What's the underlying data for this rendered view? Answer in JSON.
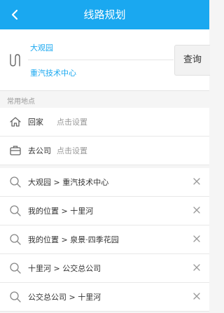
{
  "header": {
    "title": "线路规划"
  },
  "route": {
    "from": "大观园",
    "to": "重汽技术中心",
    "query_label": "查询"
  },
  "section": {
    "common_places": "常用地点"
  },
  "favorites": [
    {
      "label": "回家",
      "hint": "点击设置",
      "icon": "home-icon"
    },
    {
      "label": "去公司",
      "hint": "点击设置",
      "icon": "briefcase-icon"
    }
  ],
  "history": [
    {
      "text": "大观园 > 重汽技术中心"
    },
    {
      "text": "我的位置 > 十里河"
    },
    {
      "text": "我的位置 > 泉景·四季花园"
    },
    {
      "text": "十里河 > 公交总公司"
    },
    {
      "text": "公交总公司 > 十里河"
    }
  ],
  "colors": {
    "primary": "#1aa8f0",
    "route_text": "#1aa8f0"
  }
}
